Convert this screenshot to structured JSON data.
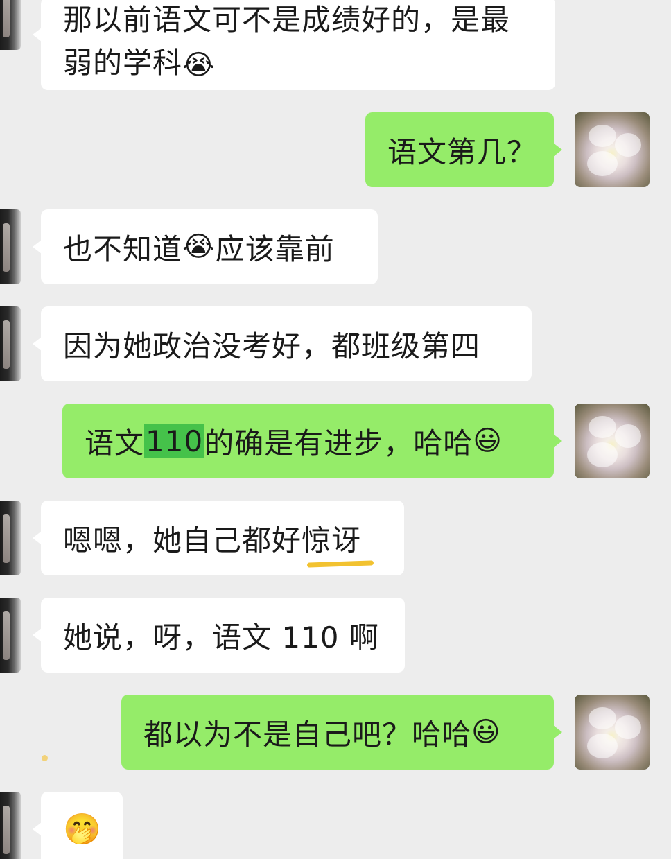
{
  "messages": [
    {
      "side": "left",
      "text_line1": "那以前语文可不是成绩好的，是最",
      "text_line2": "弱的学科",
      "emoji": "face-with-tears"
    },
    {
      "side": "right",
      "text": "语文第几？"
    },
    {
      "side": "left",
      "text_a": "也不知道",
      "emoji": "face-with-tears",
      "text_b": "应该靠前"
    },
    {
      "side": "left",
      "text": "因为她政治没考好，都班级第四"
    },
    {
      "side": "right",
      "text_a": "语文",
      "highlight": "110",
      "text_b": "的确是有进步，哈哈",
      "emoji": "smiley"
    },
    {
      "side": "left",
      "text": "嗯嗯，她自己都好惊讶"
    },
    {
      "side": "left",
      "text": "她说，呀，语文 110 啊"
    },
    {
      "side": "right",
      "text": "都以为不是自己吧？哈哈",
      "emoji": "smiley"
    },
    {
      "side": "left",
      "emoji": "hugging-face"
    }
  ],
  "emojis": {
    "face-with-tears": "😭",
    "smiley": "😃",
    "hugging-face": "🤭"
  },
  "colors": {
    "background": "#ededed",
    "incoming_bubble": "#ffffff",
    "outgoing_bubble": "#95ec69",
    "highlight": "#45c24a",
    "underline": "#f2c230"
  }
}
